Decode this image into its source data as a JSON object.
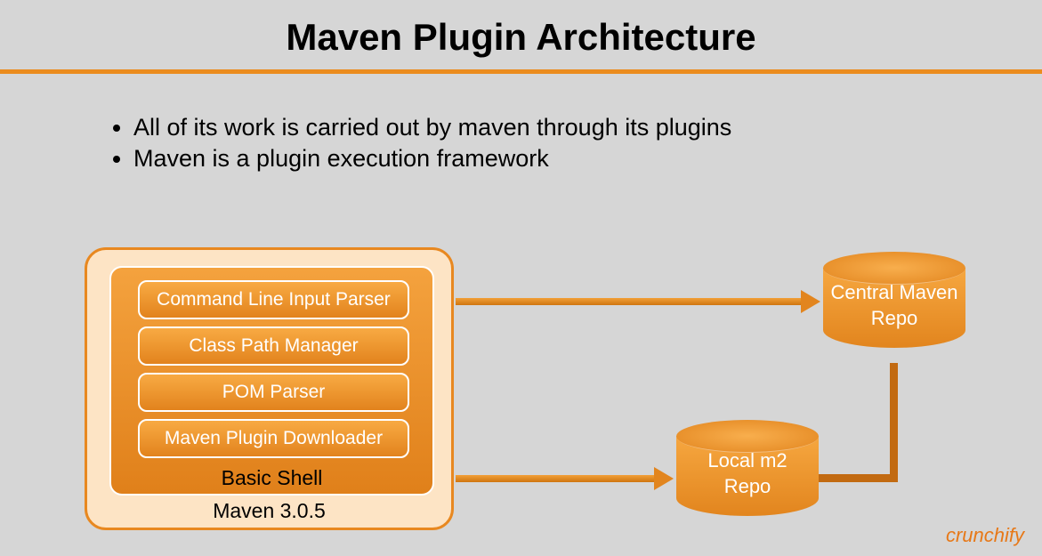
{
  "title": "Maven Plugin Architecture",
  "bullets": [
    "All of its work is carried out by maven through its plugins",
    "Maven is a plugin execution framework"
  ],
  "maven": {
    "label": "Maven 3.0.5",
    "shell_label": "Basic Shell",
    "components": [
      "Command Line Input Parser",
      "Class Path Manager",
      "POM Parser",
      "Maven Plugin Downloader"
    ]
  },
  "repos": {
    "central": {
      "line1": "Central Maven",
      "line2": "Repo"
    },
    "local": {
      "line1": "Local m2",
      "line2": "Repo"
    }
  },
  "brand": "crunchify"
}
